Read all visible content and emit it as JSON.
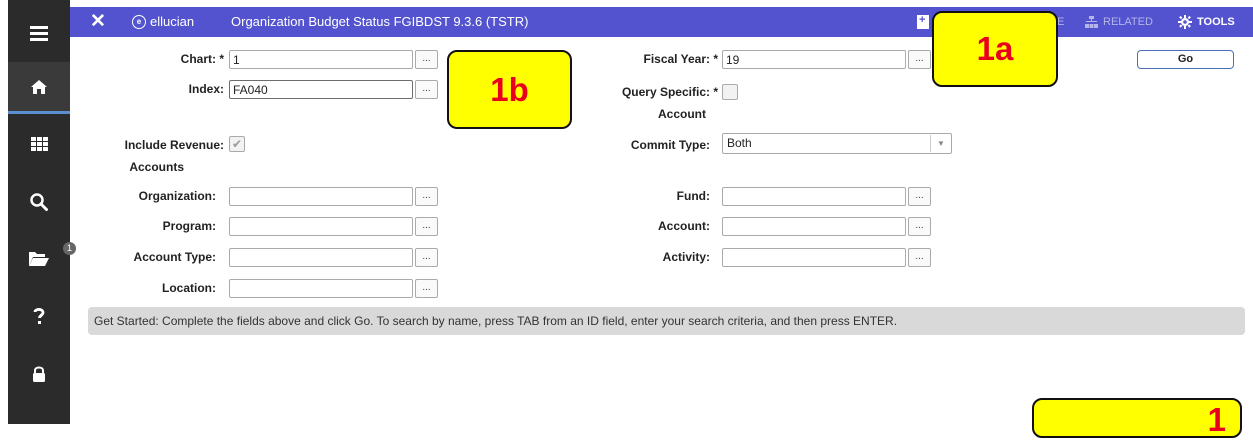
{
  "header": {
    "brand": "ellucian",
    "title": "Organization Budget Status FGIBDST 9.3.6 (TSTR)",
    "related_label": "RELATED",
    "tools_label": "TOOLS",
    "hidden_fragment": "E"
  },
  "rail": {
    "badge_count": "1"
  },
  "form": {
    "chart": {
      "label": "Chart: *",
      "value": "1"
    },
    "fiscal_year": {
      "label": "Fiscal Year: *",
      "value": "19"
    },
    "index": {
      "label": "Index:",
      "value": "FA040"
    },
    "query_specific": {
      "label_line1": "Query Specific: *",
      "label_line2": "Account",
      "checked": false
    },
    "include_revenue": {
      "label_line1": "Include Revenue:",
      "label_line2": "Accounts",
      "checked": true
    },
    "commit_type": {
      "label": "Commit Type:",
      "value": "Both"
    },
    "organization": {
      "label": "Organization:",
      "value": ""
    },
    "fund": {
      "label": "Fund:",
      "value": ""
    },
    "program": {
      "label": "Program:",
      "value": ""
    },
    "account": {
      "label": "Account:",
      "value": ""
    },
    "account_type": {
      "label": "Account Type:",
      "value": ""
    },
    "activity": {
      "label": "Activity:",
      "value": ""
    },
    "location": {
      "label": "Location:",
      "value": ""
    },
    "lov_label": "...",
    "check_mark": "✔",
    "go_label": "Go"
  },
  "status_message": "Get Started: Complete the fields above and click Go. To search by name, press TAB from an ID field, enter your search criteria, and then press ENTER.",
  "callouts": {
    "a": "1a",
    "b": "1b",
    "c": "1"
  },
  "colors": {
    "header_bg": "#5353cf",
    "rail_bg": "#2b2b2b",
    "callout_bg": "#ffff00",
    "callout_text": "#e8001c"
  }
}
